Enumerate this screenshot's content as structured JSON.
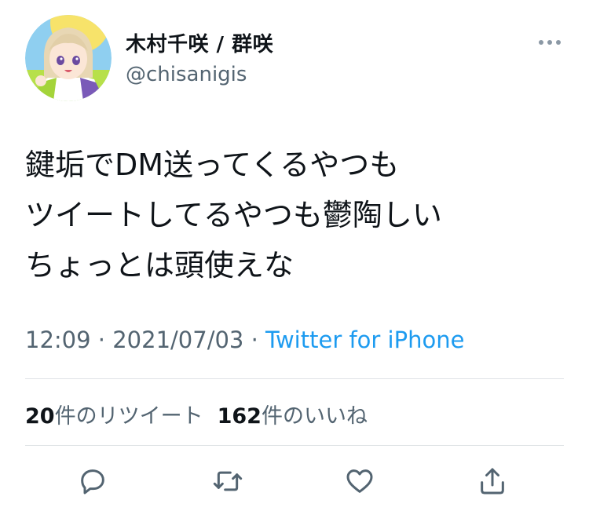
{
  "author": {
    "display_name": "木村千咲 / 群咲",
    "handle": "@chisanigis",
    "avatar_icon": "user-avatar-icon"
  },
  "tweet": {
    "lines": [
      "鍵垢でDM送ってくるやつも",
      "ツイートしてるやつも鬱陶しい",
      "ちょっとは頭使えな"
    ]
  },
  "meta": {
    "time": "12:09",
    "sep1": " · ",
    "date": "2021/07/03",
    "sep2": " · ",
    "source": "Twitter for iPhone"
  },
  "stats": {
    "retweets_count": "20",
    "retweets_label": "件のリツイート",
    "likes_count": "162",
    "likes_label": "件のいいね"
  },
  "actions": [
    "reply-icon",
    "retweet-icon",
    "like-icon",
    "share-icon"
  ],
  "colors": {
    "text": "#0f1419",
    "secondary": "#536471",
    "link": "#1d9bf0",
    "divider": "#dfe3e6"
  }
}
